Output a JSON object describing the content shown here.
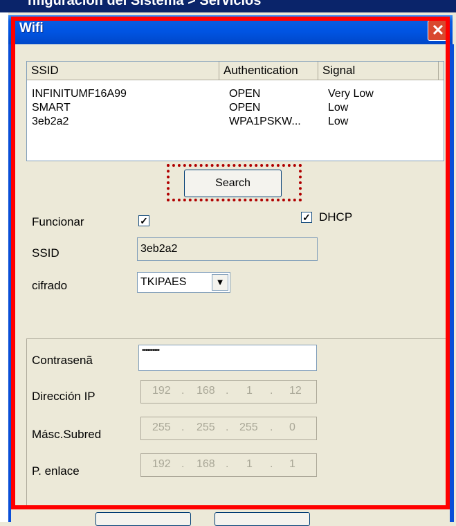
{
  "window": {
    "title": "Wifi"
  },
  "background_title": "nfiguración del Sistema > Servicios",
  "list": {
    "columns": [
      "SSID",
      "Authentication",
      "Signal"
    ],
    "rows": [
      {
        "ssid": "INFINITUMF16A99",
        "auth": "OPEN",
        "signal": "Very Low"
      },
      {
        "ssid": "SMART",
        "auth": "OPEN",
        "signal": "Low"
      },
      {
        "ssid": "3eb2a2",
        "auth": "WPA1PSKW...",
        "signal": "Low"
      }
    ]
  },
  "search_label": "Search",
  "form": {
    "funcionar_label": "Funcionar",
    "funcionar_checked": true,
    "dhcp_label": "DHCP",
    "dhcp_checked": true,
    "ssid_label": "SSID",
    "ssid_value": "3eb2a2",
    "cifrado_label": "cifrado",
    "cifrado_value": "TKIPAES",
    "password_label": "Contrasenã",
    "password_value": "••••••••••",
    "ip_label": "Dirección IP",
    "ip": [
      "192",
      "168",
      "1",
      "12"
    ],
    "mask_label": "Másc.Subred",
    "mask": [
      "255",
      "255",
      "255",
      "0"
    ],
    "gateway_label": "P. enlace",
    "gateway": [
      "192",
      "168",
      "1",
      "1"
    ]
  },
  "colors": {
    "highlight": "#ff0000",
    "title_bar": "#0054e3",
    "dialog_bg": "#ece9d8"
  }
}
